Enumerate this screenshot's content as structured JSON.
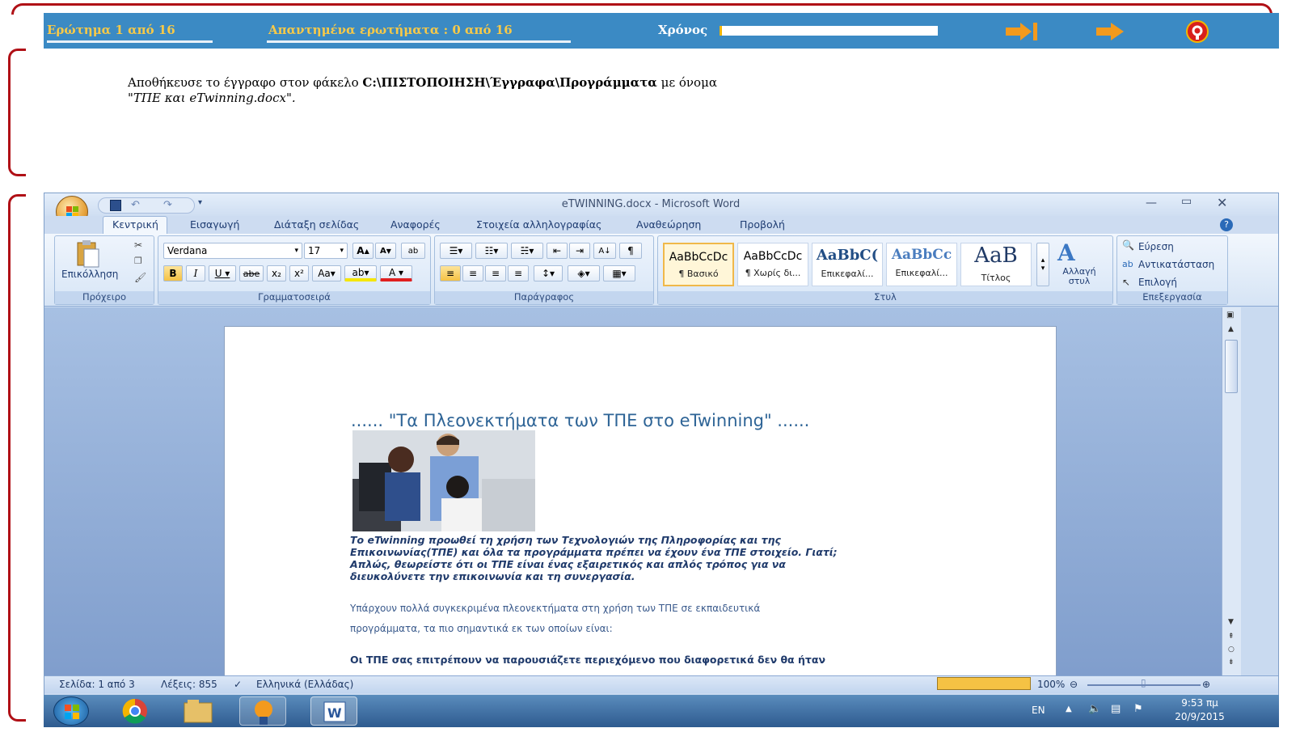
{
  "exam": {
    "question_counter": "Ερώτημα 1 από 16",
    "answered_counter": "Απαντημένα ερωτήματα  :  0  από  16",
    "time_label": "Χρόνος",
    "question_text_prefix": "Αποθήκευσε το έγγραφο στον φάκελο ",
    "question_path": "C:\\ΠΙΣΤΟΠΟΙΗΣΗ\\Έγγραφα\\Προγράμματα",
    "question_text_suffix": " με όνομα",
    "question_filename": "\"ΤΠΕ και eTwinning.docx\"."
  },
  "word": {
    "title": "eTWINNING.docx - Microsoft Word",
    "tabs": [
      "Κεντρική",
      "Εισαγωγή",
      "Διάταξη σελίδας",
      "Αναφορές",
      "Στοιχεία αλληλογραφίας",
      "Αναθεώρηση",
      "Προβολή"
    ],
    "clipboard": {
      "paste_label": "Επικόλληση",
      "group_label": "Πρόχειρο"
    },
    "font": {
      "family": "Verdana",
      "size": "17",
      "group_label": "Γραμματοσειρά"
    },
    "paragraph": {
      "group_label": "Παράγραφος"
    },
    "styles": {
      "items": [
        {
          "sample": "AaBbCcDc",
          "name": "¶ Βασικό"
        },
        {
          "sample": "AaBbCcDc",
          "name": "¶ Χωρίς δι..."
        },
        {
          "sample": "AaBbC(",
          "name": "Επικεφαλί..."
        },
        {
          "sample": "AaBbCc",
          "name": "Επικεφαλί..."
        },
        {
          "sample": "AaB",
          "name": "Τίτλος"
        }
      ],
      "change_label": "Αλλαγή στυλ",
      "group_label": "Στυλ"
    },
    "editing": {
      "find": "Εύρεση",
      "replace": "Αντικατάσταση",
      "select": "Επιλογή",
      "group_label": "Επεξεργασία"
    },
    "document": {
      "heading": "...... \"Τα Πλεονεκτήματα των ΤΠΕ στο eTwinning\"  ......",
      "para1": [
        "Το eTwinning προωθεί τη χρήση των Τεχνολογιών της Πληροφορίας και της",
        "Επικοινωνίας(ΤΠΕ) και όλα τα προγράμματα πρέπει να έχουν ένα ΤΠΕ στοιχείο. Γιατί;",
        "Απλώς, θεωρείστε ότι οι ΤΠΕ είναι ένας εξαιρετικός και απλός τρόπος για να",
        "διευκολύνετε την επικοινωνία και τη συνεργασία."
      ],
      "para2": [
        "Υπάρχουν πολλά συγκεκριμένα πλεονεκτήματα στη χρήση των ΤΠΕ σε εκπαιδευτικά",
        "προγράμματα, τα πιο σημαντικά εκ των οποίων είναι:"
      ],
      "para3": "Οι ΤΠΕ σας επιτρέπουν να παρουσιάζετε περιεχόμενο  που διαφορετικά δεν θα ήταν"
    },
    "status": {
      "page": "Σελίδα: 1 από 3",
      "words": "Λέξεις: 855",
      "language": "Ελληνικά (Ελλάδας)",
      "zoom": "100%"
    }
  },
  "taskbar": {
    "lang": "EN",
    "time": "9:53 πμ",
    "date": "20/9/2015"
  },
  "colors": {
    "exam_bar": "#3b8ac4",
    "exam_text": "#f7c948",
    "bracket": "#b01016",
    "doc_heading": "#2e6496"
  }
}
